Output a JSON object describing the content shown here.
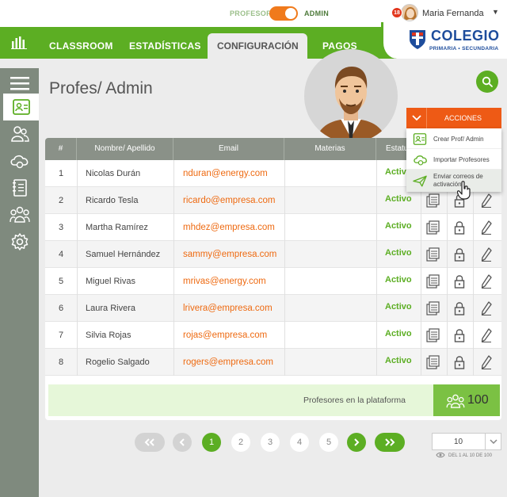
{
  "topbar": {
    "role_left": "PROFESOR",
    "role_right": "ADMIN",
    "notifications": "18",
    "user_name": "Maria Fernanda"
  },
  "nav": {
    "items": [
      "CLASSROOM",
      "ESTADÍSTICAS",
      "CONFIGURACIÓN",
      "PAGOS"
    ],
    "active": "CONFIGURACIÓN"
  },
  "school": {
    "name": "COLEGIO",
    "subtitle": "PRIMARIA • SECUNDARIA"
  },
  "sidebar": {
    "icons": [
      "menu-icon",
      "profile-card-icon",
      "users-icon",
      "cloud-icon",
      "notebook-icon",
      "group-icon",
      "gear-icon"
    ]
  },
  "page": {
    "title": "Profes/ Admin"
  },
  "actions": {
    "label": "ACCIONES",
    "items": [
      "Crear Prof/ Admin",
      "Importar Profesores",
      "Enviar correos de activación"
    ]
  },
  "table": {
    "headers": [
      "#",
      "Nombre/ Apellido",
      "Email",
      "Materias",
      "Estatus"
    ],
    "rows": [
      {
        "num": "1",
        "name": "Nicolas Durán",
        "email": "nduran@energy.com",
        "status": "Activo"
      },
      {
        "num": "2",
        "name": "Ricardo Tesla",
        "email": "ricardo@empresa.com",
        "status": "Activo"
      },
      {
        "num": "3",
        "name": "Martha Ramírez",
        "email": "mhdez@empresa.com",
        "status": "Activo"
      },
      {
        "num": "4",
        "name": "Samuel Hernández",
        "email": "sammy@empresa.com",
        "status": "Activo"
      },
      {
        "num": "5",
        "name": "Miguel Rivas",
        "email": "mrivas@energy.com",
        "status": "Activo"
      },
      {
        "num": "6",
        "name": "Laura Rivera",
        "email": "lrivera@empresa.com",
        "status": "Activo"
      },
      {
        "num": "7",
        "name": "Silvia Rojas",
        "email": "rojas@empresa.com",
        "status": "Activo"
      },
      {
        "num": "8",
        "name": "Rogelio Salgado",
        "email": "rogers@empresa.com",
        "status": "Activo"
      }
    ],
    "footer_label": "Profesores en la plataforma",
    "footer_count": "100"
  },
  "pagination": {
    "pages": [
      "1",
      "2",
      "3",
      "4",
      "5"
    ],
    "current": "1",
    "per_page": "10",
    "range_text": "DEL 1 AL 10 DE 100"
  },
  "colors": {
    "brand_green": "#5cae23",
    "accent_orange": "#ee5a15",
    "email_orange": "#ee6a11",
    "sidebar_gray": "#7f8a7e"
  }
}
